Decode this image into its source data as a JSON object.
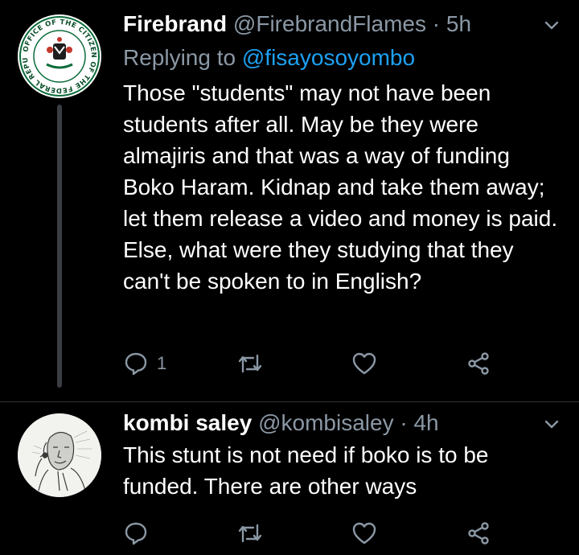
{
  "tweets": [
    {
      "name": "Firebrand",
      "handle": "@FirebrandFlames",
      "separator": "·",
      "time": "5h",
      "replying_prefix": "Replying to",
      "replying_to": "@fisayosoyombo",
      "text": "Those \"students\" may not have been students after all. May be they were almajiris and that was a way of funding Boko Haram. Kidnap and take them away; let them release a video and money is paid. Else, what were they studying that they can't be spoken to in English?",
      "reply_count": "1",
      "avatar": "office-of-the-citizen-seal-icon",
      "seal_text": "OFFICE OF THE CITIZEN OF THE FEDERAL REPUBLIC OF NIGERIA"
    },
    {
      "name": "kombi saley",
      "handle": "@kombisaley",
      "separator": "·",
      "time": "4h",
      "text": "This stunt is not need if boko is to be funded. There are other ways",
      "avatar": "sketch-portrait-icon"
    }
  ],
  "colors": {
    "background": "#000000",
    "text": "#ffffff",
    "muted": "#8b98a5",
    "link": "#1da1f2",
    "thread_line": "#3a3d41"
  },
  "icons": [
    "reply-icon",
    "retweet-icon",
    "like-icon",
    "share-icon",
    "chevron-down-icon"
  ]
}
